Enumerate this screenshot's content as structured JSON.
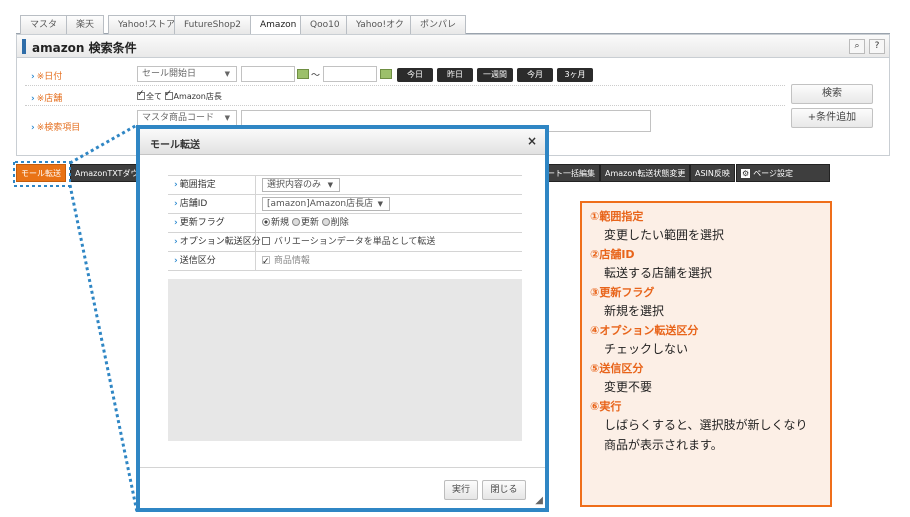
{
  "tabs": [
    "マスタ",
    "楽天",
    "Yahoo!ストア",
    "FutureShop2",
    "Amazon",
    "Qoo10",
    "Yahoo!オク",
    "ポンパレ"
  ],
  "active_tab": "Amazon",
  "header": {
    "title": "amazon 検索条件",
    "help": "?"
  },
  "form": {
    "date": {
      "label": "※日付",
      "select": "セール開始日",
      "tilde": "～",
      "buttons": [
        "今日",
        "昨日",
        "一週間",
        "今月",
        "3ヶ月"
      ]
    },
    "store": {
      "label": "※店舗",
      "all": "全て",
      "store_name": "Amazon店長"
    },
    "item": {
      "label": "※検索項目",
      "select": "マスタ商品コード"
    },
    "search_button": "検索",
    "add_condition_button": "+条件追加"
  },
  "toolbar": {
    "mall_transfer": "モール転送",
    "amazon_txt": "AmazonTXTダウ",
    "bulk_edit": "ート一括編集",
    "status_change": "Amazon転送状態変更",
    "asin": "ASIN反映",
    "page_settings": "ページ設定"
  },
  "modal": {
    "title": "モール転送",
    "close": "×",
    "rows": {
      "range": {
        "label": "範囲指定",
        "value": "選択内容のみ"
      },
      "shop": {
        "label": "店舗ID",
        "value": "[amazon]Amazon店長店"
      },
      "flag": {
        "label": "更新フラグ",
        "opt1": "新規",
        "opt2": "更新",
        "opt3": "削除"
      },
      "option": {
        "label": "オプション転送区分",
        "value": "バリエーションデータを単品として転送"
      },
      "send": {
        "label": "送信区分",
        "value": "商品情報"
      }
    },
    "run_button": "実行",
    "close_button": "閉じる"
  },
  "callout": [
    {
      "head": "①範囲指定",
      "desc": "変更したい範囲を選択"
    },
    {
      "head": "②店舗ID",
      "desc": "転送する店舗を選択"
    },
    {
      "head": "③更新フラグ",
      "desc": "新規を選択"
    },
    {
      "head": "④オプション転送区分",
      "desc": "チェックしない"
    },
    {
      "head": "⑤送信区分",
      "desc": "変更不要"
    },
    {
      "head": "⑥実行",
      "desc": "しばらくすると、選択肢が新しくなり",
      "desc2": "商品が表示されます。"
    }
  ],
  "colors": {
    "accent_blue": "#2f86c4",
    "callout_orange": "#ef6e1a",
    "callout_bg": "#fcefe6",
    "toolbar_orange": "#e97316"
  }
}
